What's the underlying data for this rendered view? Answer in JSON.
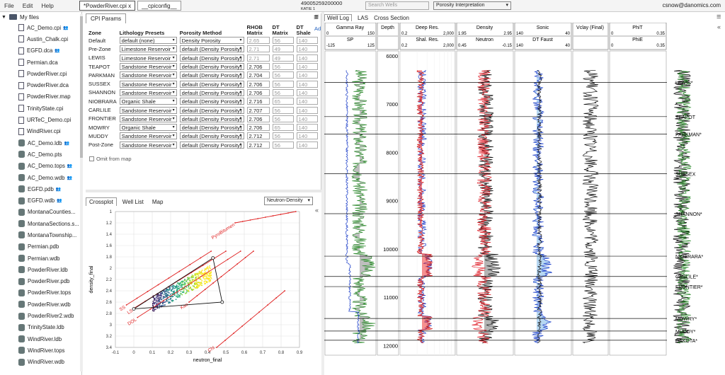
{
  "menu": [
    "File",
    "Edit",
    "Help"
  ],
  "file_tabs": [
    "*PowderRiver.cpi x",
    "__cpiconfig__"
  ],
  "well": {
    "id": "49005259200000",
    "name": "KATIE 1"
  },
  "search_placeholder": "Search Wells",
  "interpretation": "Porosity Interpretation",
  "user": "csnow@danomics.com",
  "files": {
    "root": "My files",
    "items": [
      {
        "name": "AC_Demo.cpi",
        "type": "file",
        "shared": true
      },
      {
        "name": "Austin_Chalk.cpi",
        "type": "file",
        "shared": false
      },
      {
        "name": "EGFD.dca",
        "type": "file",
        "shared": true
      },
      {
        "name": "Permian.dca",
        "type": "file",
        "shared": false
      },
      {
        "name": "PowderRiver.cpi",
        "type": "file",
        "shared": false
      },
      {
        "name": "PowderRiver.dca",
        "type": "file",
        "shared": false
      },
      {
        "name": "PowderRiver.map",
        "type": "file",
        "shared": false
      },
      {
        "name": "TrinityState.cpi",
        "type": "file",
        "shared": false
      },
      {
        "name": "URTeC_Demo.cpi",
        "type": "file",
        "shared": false
      },
      {
        "name": "WindRiver.cpi",
        "type": "file",
        "shared": false
      },
      {
        "name": "AC_Demo.ldb",
        "type": "db",
        "shared": true
      },
      {
        "name": "AC_Demo.pts",
        "type": "db",
        "shared": false
      },
      {
        "name": "AC_Demo.tops",
        "type": "db",
        "shared": true
      },
      {
        "name": "AC_Demo.wdb",
        "type": "db",
        "shared": true
      },
      {
        "name": "EGFD.pdb",
        "type": "db",
        "shared": true
      },
      {
        "name": "EGFD.wdb",
        "type": "db",
        "shared": true
      },
      {
        "name": "MontanaCounties...",
        "type": "db",
        "shared": false
      },
      {
        "name": "MontanaSections.s...",
        "type": "db",
        "shared": false
      },
      {
        "name": "MontanaTownship...",
        "type": "db",
        "shared": false
      },
      {
        "name": "Permian.pdb",
        "type": "db",
        "shared": false
      },
      {
        "name": "Permian.wdb",
        "type": "db",
        "shared": false
      },
      {
        "name": "PowderRiver.ldb",
        "type": "db",
        "shared": false
      },
      {
        "name": "PowderRiver.pdb",
        "type": "db",
        "shared": false
      },
      {
        "name": "PowderRiver.tops",
        "type": "db",
        "shared": false
      },
      {
        "name": "PowderRiver.wdb",
        "type": "db",
        "shared": false
      },
      {
        "name": "PowderRiver2.wdb",
        "type": "db",
        "shared": false
      },
      {
        "name": "TrinityState.ldb",
        "type": "db",
        "shared": false
      },
      {
        "name": "WindRiver.ldb",
        "type": "db",
        "shared": false
      },
      {
        "name": "WindRiver.tops",
        "type": "db",
        "shared": false
      },
      {
        "name": "WindRiver.wdb",
        "type": "db",
        "shared": false
      }
    ]
  },
  "cpi": {
    "tab": "CPI Params",
    "headers": [
      "Zone",
      "Lithology Presets",
      "Porosity Method",
      "RHOB Matrix",
      "DT Matrix",
      "DT Shale"
    ],
    "add_label": "Ad",
    "rows": [
      {
        "zone": "Default",
        "litho": "default (none)",
        "method": "Density Porosity",
        "rhob": "2.65",
        "dt": "56",
        "dts": "140",
        "rhob_gray": true
      },
      {
        "zone": "Pre-Zone",
        "litho": "Limestone Reservoir",
        "method": "default (Density Porosity)",
        "rhob": "2.71",
        "dt": "49",
        "dts": "140",
        "rhob_gray": true
      },
      {
        "zone": "LEWIS",
        "litho": "Limestone Reservoir",
        "method": "default (Density Porosity)",
        "rhob": "2.71",
        "dt": "49",
        "dts": "140",
        "rhob_gray": true
      },
      {
        "zone": "TEAPOT",
        "litho": "Sandstone Reservoir",
        "method": "default (Density Porosity)",
        "rhob": "2.706",
        "dt": "56",
        "dts": "140",
        "rhob_gray": false
      },
      {
        "zone": "PARKMAN",
        "litho": "Sandstone Reservoir",
        "method": "default (Density Porosity)",
        "rhob": "2.704",
        "dt": "56",
        "dts": "140",
        "rhob_gray": false
      },
      {
        "zone": "SUSSEX",
        "litho": "Sandstone Reservoir",
        "method": "default (Density Porosity)",
        "rhob": "2.706",
        "dt": "56",
        "dts": "140",
        "rhob_gray": false
      },
      {
        "zone": "SHANNON",
        "litho": "Sandstone Reservoir",
        "method": "default (Density Porosity)",
        "rhob": "2.706",
        "dt": "56",
        "dts": "140",
        "rhob_gray": false
      },
      {
        "zone": "NIOBRARA",
        "litho": "Organic Shale",
        "method": "default (Density Porosity)",
        "rhob": "2.716",
        "dt": "65",
        "dts": "140",
        "rhob_gray": false
      },
      {
        "zone": "CARLILE",
        "litho": "Sandstone Reservoir",
        "method": "default (Density Porosity)",
        "rhob": "2.707",
        "dt": "56",
        "dts": "140",
        "rhob_gray": false
      },
      {
        "zone": "FRONTIER",
        "litho": "Sandstone Reservoir",
        "method": "default (Density Porosity)",
        "rhob": "2.706",
        "dt": "56",
        "dts": "140",
        "rhob_gray": false
      },
      {
        "zone": "MOWRY",
        "litho": "Organic Shale",
        "method": "default (Density Porosity)",
        "rhob": "2.706",
        "dt": "65",
        "dts": "140",
        "rhob_gray": false
      },
      {
        "zone": "MUDDY",
        "litho": "Sandstone Reservoir",
        "method": "default (Density Porosity)",
        "rhob": "2.712",
        "dt": "56",
        "dts": "140",
        "rhob_gray": false
      },
      {
        "zone": "Post-Zone",
        "litho": "Sandstone Reservoir",
        "method": "default (Density Porosity)",
        "rhob": "2.712",
        "dt": "56",
        "dts": "140",
        "rhob_gray": false
      }
    ],
    "omit_label": "Omit from map"
  },
  "crossplot": {
    "tabs": [
      "Crossplot",
      "Well List",
      "Map"
    ],
    "selector": "Neutron-Density",
    "chart_data": {
      "type": "scatter",
      "xlabel": "neutron_final",
      "ylabel": "density_final",
      "xlim": [
        -0.1,
        0.9
      ],
      "ylim": [
        3.4,
        1.0
      ],
      "xticks": [
        "-0.1",
        "0",
        "0.1",
        "0.2",
        "0.3",
        "0.4",
        "0.5",
        "0.6",
        "0.7",
        "0.8",
        "0.9"
      ],
      "yticks": [
        "1",
        "1.2",
        "1.4",
        "1.6",
        "1.8",
        "2",
        "2.2",
        "2.4",
        "2.6",
        "2.8",
        "3",
        "3.2",
        "3.4"
      ],
      "lines": [
        {
          "name": "SS",
          "pts": [
            [
              -0.04,
              2.65
            ],
            [
              0.42,
              1.7
            ]
          ]
        },
        {
          "name": "LS",
          "pts": [
            [
              0.0,
              2.71
            ],
            [
              0.5,
              1.7
            ]
          ]
        },
        {
          "name": "DOL",
          "pts": [
            [
              0.02,
              2.87
            ],
            [
              0.58,
              1.7
            ]
          ]
        },
        {
          "name": "Kao",
          "pts": [
            [
              0.3,
              2.6
            ],
            [
              0.65,
              1.7
            ]
          ]
        },
        {
          "name": "PyroBitumen",
          "pts": [
            [
              0.55,
              1.2
            ],
            [
              0.88,
              1.0
            ]
          ]
        },
        {
          "name": "Chl",
          "pts": [
            [
              0.45,
              3.4
            ],
            [
              0.82,
              2.4
            ]
          ]
        }
      ],
      "triangle": [
        [
          0.0,
          2.72
        ],
        [
          0.43,
          1.82
        ],
        [
          0.48,
          2.6
        ]
      ]
    }
  },
  "welllog": {
    "tabs": [
      "Well Log",
      "LAS",
      "Cross Section"
    ],
    "tracks": [
      {
        "t1": "Gamma Ray",
        "t1l": "0",
        "t1r": "150",
        "t2": "SP",
        "t2l": "-125",
        "t2r": "125"
      },
      {
        "t1": "Depth",
        "t1l": "",
        "t1r": "",
        "t2": "",
        "t2l": "",
        "t2r": ""
      },
      {
        "t1": "Deep Res.",
        "t1l": "0.2",
        "t1r": "2,000",
        "t2": "Shal. Res.",
        "t2l": "0.2",
        "t2r": "2,000"
      },
      {
        "t1": "Density",
        "t1l": "1.95",
        "t1r": "2.95",
        "t2": "Neutron",
        "t2l": "0.45",
        "t2r": "-0.15"
      },
      {
        "t1": "Sonic",
        "t1l": "140",
        "t1r": "40",
        "t2": "DT Faust",
        "t2l": "140",
        "t2r": "40"
      },
      {
        "t1": "Vclay (Final)",
        "t1l": "",
        "t1r": "",
        "t2": "",
        "t2l": "",
        "t2r": ""
      },
      {
        "t1": "PhiT",
        "t1l": "0",
        "t1r": "0.35",
        "t2": "PhiE",
        "t2l": "0",
        "t2r": "0.35"
      }
    ],
    "depths": [
      "6000",
      "7000",
      "8000",
      "9000",
      "10000",
      "11000",
      "12000"
    ],
    "tops": [
      {
        "name": "LEWIS*",
        "depth": 6550
      },
      {
        "name": "TEAPOT",
        "depth": 7260
      },
      {
        "name": "PARKMAN*",
        "depth": 7620
      },
      {
        "name": "SUSSEX",
        "depth": 8440
      },
      {
        "name": "SHANNON*",
        "depth": 9270
      },
      {
        "name": "NIOBRARA*",
        "depth": 10150
      },
      {
        "name": "CARLILE*",
        "depth": 10570
      },
      {
        "name": "FRONTIER*",
        "depth": 10780
      },
      {
        "name": "MOWRY*",
        "depth": 11440
      },
      {
        "name": "MUDDY*",
        "depth": 11700
      },
      {
        "name": "DAKOTA*",
        "depth": 11890
      }
    ]
  },
  "colors": {
    "accent": "#1f5fbf",
    "gr": "#2a8a2a",
    "res": "#d02020",
    "neu": "#e0202a",
    "sonic": "#1a3cc8"
  }
}
